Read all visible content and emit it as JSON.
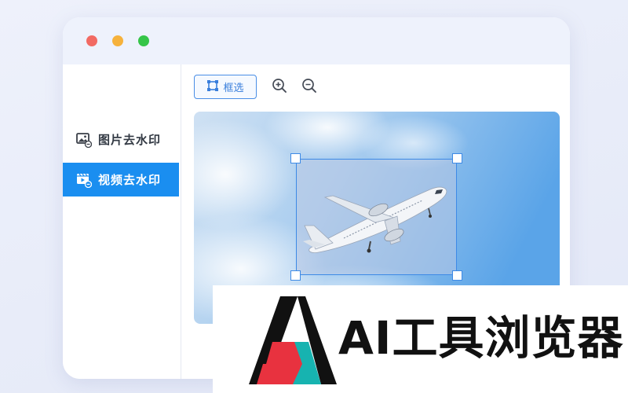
{
  "window": {
    "traffic_lights": [
      {
        "name": "close",
        "color": "#f26a63"
      },
      {
        "name": "minimize",
        "color": "#f6b23c"
      },
      {
        "name": "maximize",
        "color": "#35c548"
      }
    ]
  },
  "sidebar": {
    "items": [
      {
        "label": "图片去水印",
        "icon": "image-watermark-icon",
        "active": false
      },
      {
        "label": "视频去水印",
        "icon": "video-watermark-icon",
        "active": true
      }
    ],
    "active_color": "#1a8ef0"
  },
  "toolbar": {
    "select_label": "框选",
    "select_icon": "crop-frame-icon",
    "zoom_in_icon": "zoom-in-icon",
    "zoom_out_icon": "zoom-out-icon",
    "accent": "#3a7fdc"
  },
  "canvas": {
    "image": "airplane-in-sky",
    "selection": "crop-box"
  },
  "banner": {
    "brand": "AI工具浏览器",
    "logo_colors": {
      "dark": "#111111",
      "red": "#e8323f",
      "teal": "#17b3b0"
    }
  }
}
